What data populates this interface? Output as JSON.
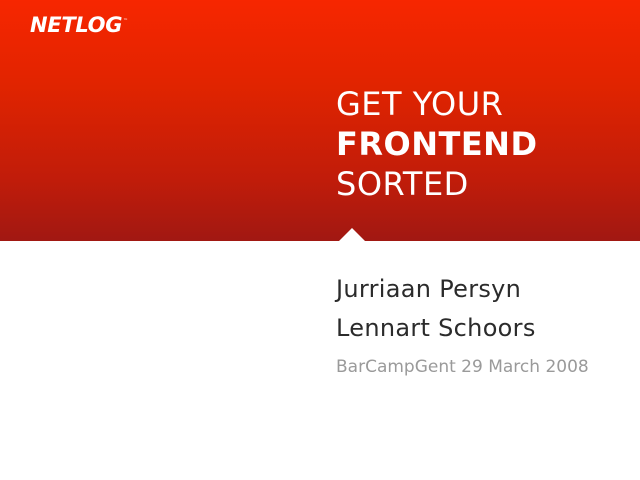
{
  "brand": {
    "logo_text": "NETLOG",
    "trademark": "™",
    "accent_color_top": "#f72600",
    "accent_color_bottom": "#a11812"
  },
  "title": {
    "line1": "GET YOUR",
    "line2": "FRONTEND",
    "line3": "SORTED"
  },
  "authors": [
    "Jurriaan Persyn",
    "Lennart Schoors"
  ],
  "event": "BarCampGent 29 March 2008"
}
